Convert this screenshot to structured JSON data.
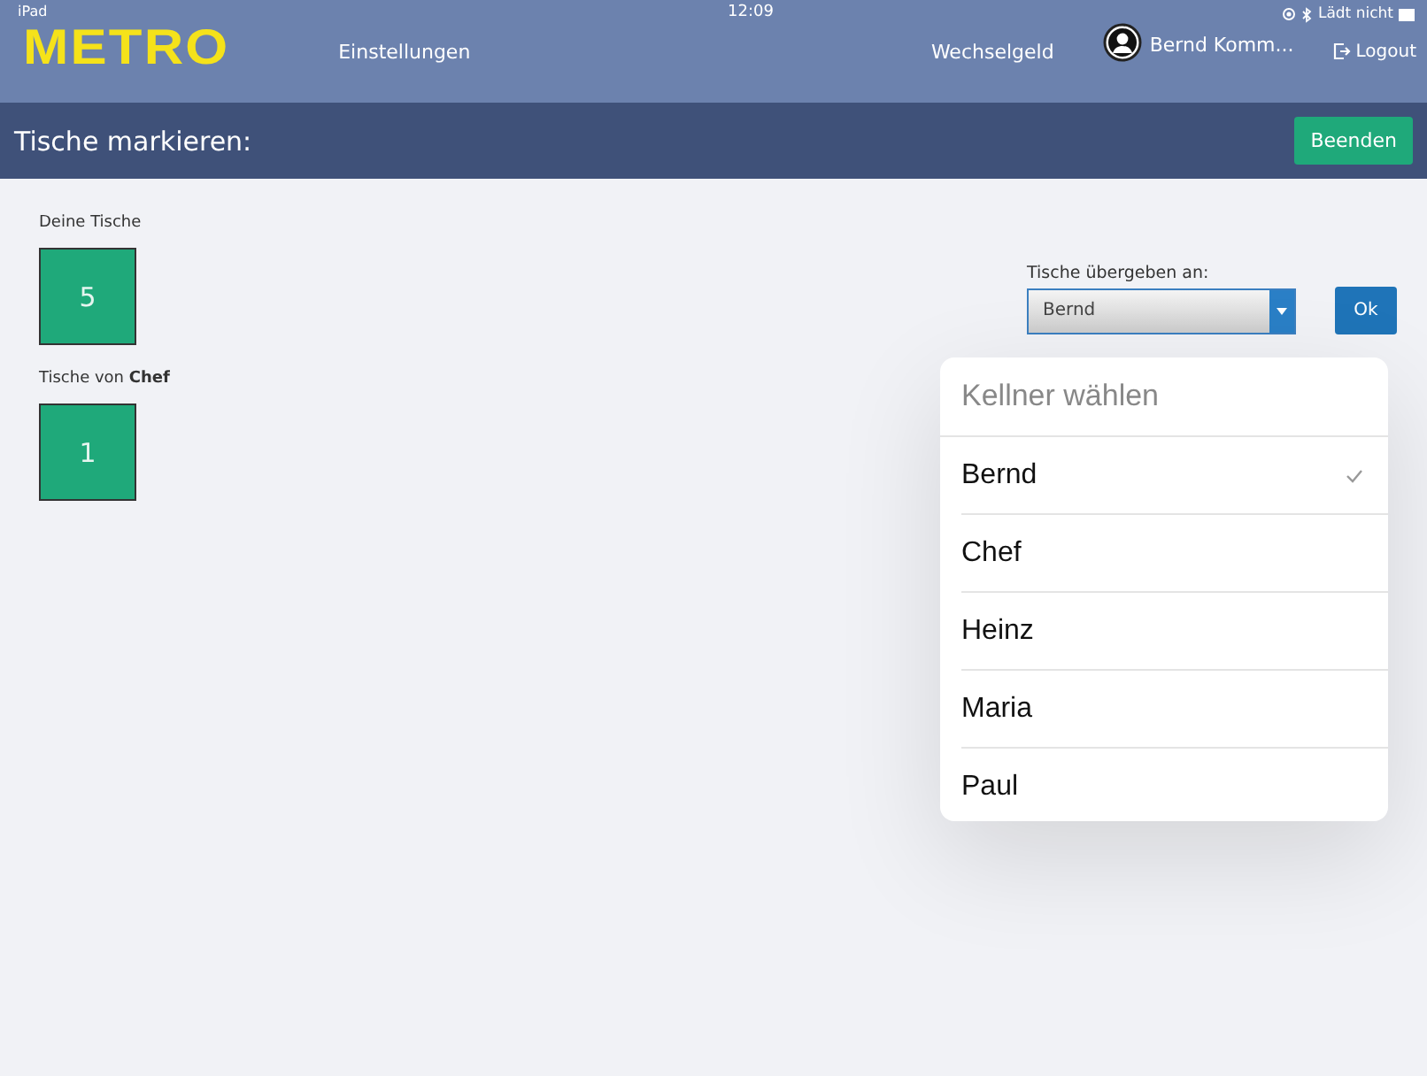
{
  "status_bar": {
    "device": "iPad",
    "time": "12:09",
    "battery": "Lädt nicht"
  },
  "top_bar": {
    "logo": "METRO",
    "nav": [
      "Einstellungen",
      "Wechselgeld"
    ],
    "user": "Bernd Komm...",
    "logout": "Logout"
  },
  "title_bar": {
    "title": "Tische markieren:",
    "button": "Beenden"
  },
  "sections": [
    {
      "label": "Deine Tische",
      "tables": [
        "5"
      ]
    },
    {
      "label": "Tische von **Chef**",
      "tables": [
        "1"
      ]
    }
  ],
  "transfer": {
    "label": "Tische übergeben an:",
    "value": "Bernd",
    "ok": "Ok"
  },
  "picker": {
    "title": "Kellner wählen",
    "items": [
      {
        "name": "Bernd",
        "selected": true
      },
      {
        "name": "Chef",
        "selected": false
      },
      {
        "name": "Heinz",
        "selected": false
      },
      {
        "name": "Maria",
        "selected": false
      },
      {
        "name": "Paul",
        "selected": false
      }
    ]
  }
}
